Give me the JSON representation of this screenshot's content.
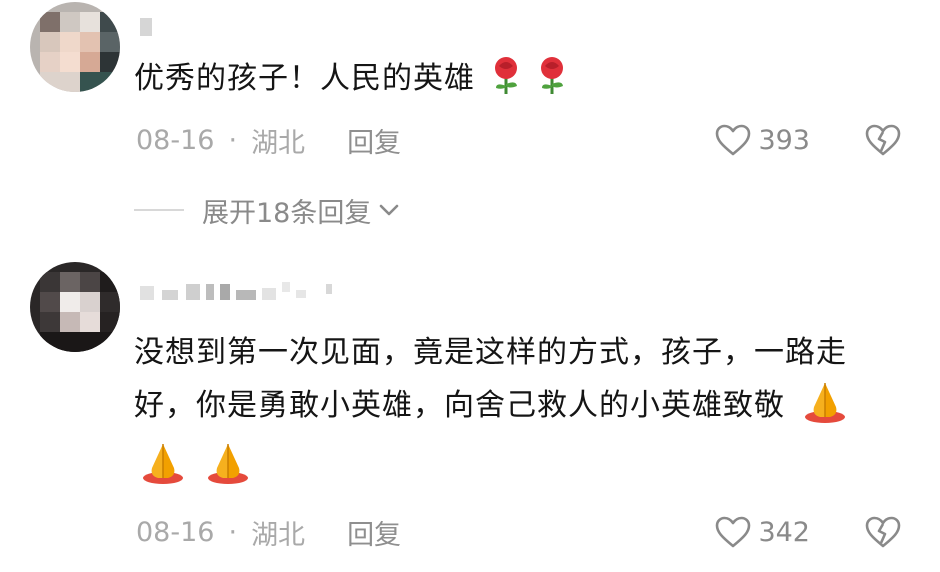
{
  "comments": [
    {
      "text": "优秀的孩子！人民的英雄",
      "emojis": [
        "rose",
        "rose"
      ],
      "date": "08-16",
      "separator": "·",
      "region": "湖北",
      "reply_label": "回复",
      "likes": "393",
      "expand_label": "展开18条回复"
    },
    {
      "text": "没想到第一次见面，竟是这样的方式，孩子，一路走好，你是勇敢小英雄，向舍己救人的小英雄致敬",
      "emojis": [
        "folded-hands",
        "folded-hands",
        "folded-hands"
      ],
      "date": "08-16",
      "separator": "·",
      "region": "湖北",
      "reply_label": "回复",
      "likes": "342"
    }
  ],
  "colors": {
    "meta_gray": "#a9a9a9",
    "text": "#151515",
    "icon_gray": "#8a8a8a",
    "rose": "#e0303a",
    "hands": "#f6b01e"
  }
}
